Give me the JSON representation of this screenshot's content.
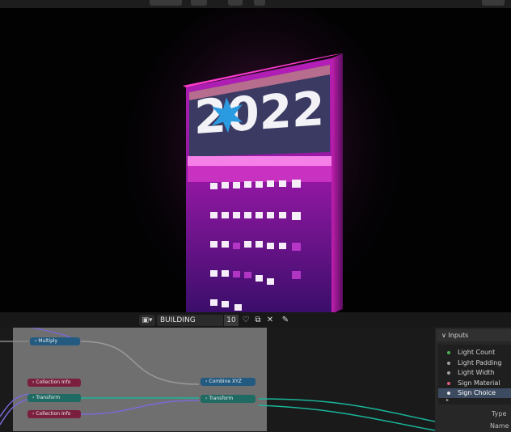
{
  "node_editor": {
    "editor_type_icon": "node-editor-icon",
    "tree_name": "BUILDING",
    "users_count": "10",
    "icons": [
      "fake-user-shield-icon",
      "duplicate-icon",
      "close-icon",
      "pin-icon"
    ]
  },
  "nodes": {
    "multiply": "Multiply",
    "collection_info_1": "Collection Info",
    "transform_1": "Transform",
    "collection_info_2": "Collection Info",
    "combine_xyz": "Combine XYZ",
    "transform_2": "Transform"
  },
  "inputs_panel": {
    "title": "Inputs",
    "items": [
      {
        "label": "Light Count",
        "color": "#4caf50"
      },
      {
        "label": "Light Padding",
        "color": "#a0a0a0"
      },
      {
        "label": "Light Width",
        "color": "#a0a0a0"
      },
      {
        "label": "Sign Material",
        "color": "#e05a7a"
      },
      {
        "label": "Sign Choice",
        "color": "#e8e8e8"
      }
    ],
    "type_label": "Type",
    "name_label": "Name"
  },
  "viewport": {
    "sign_text": "2022",
    "accent": "#ff3bd6"
  }
}
